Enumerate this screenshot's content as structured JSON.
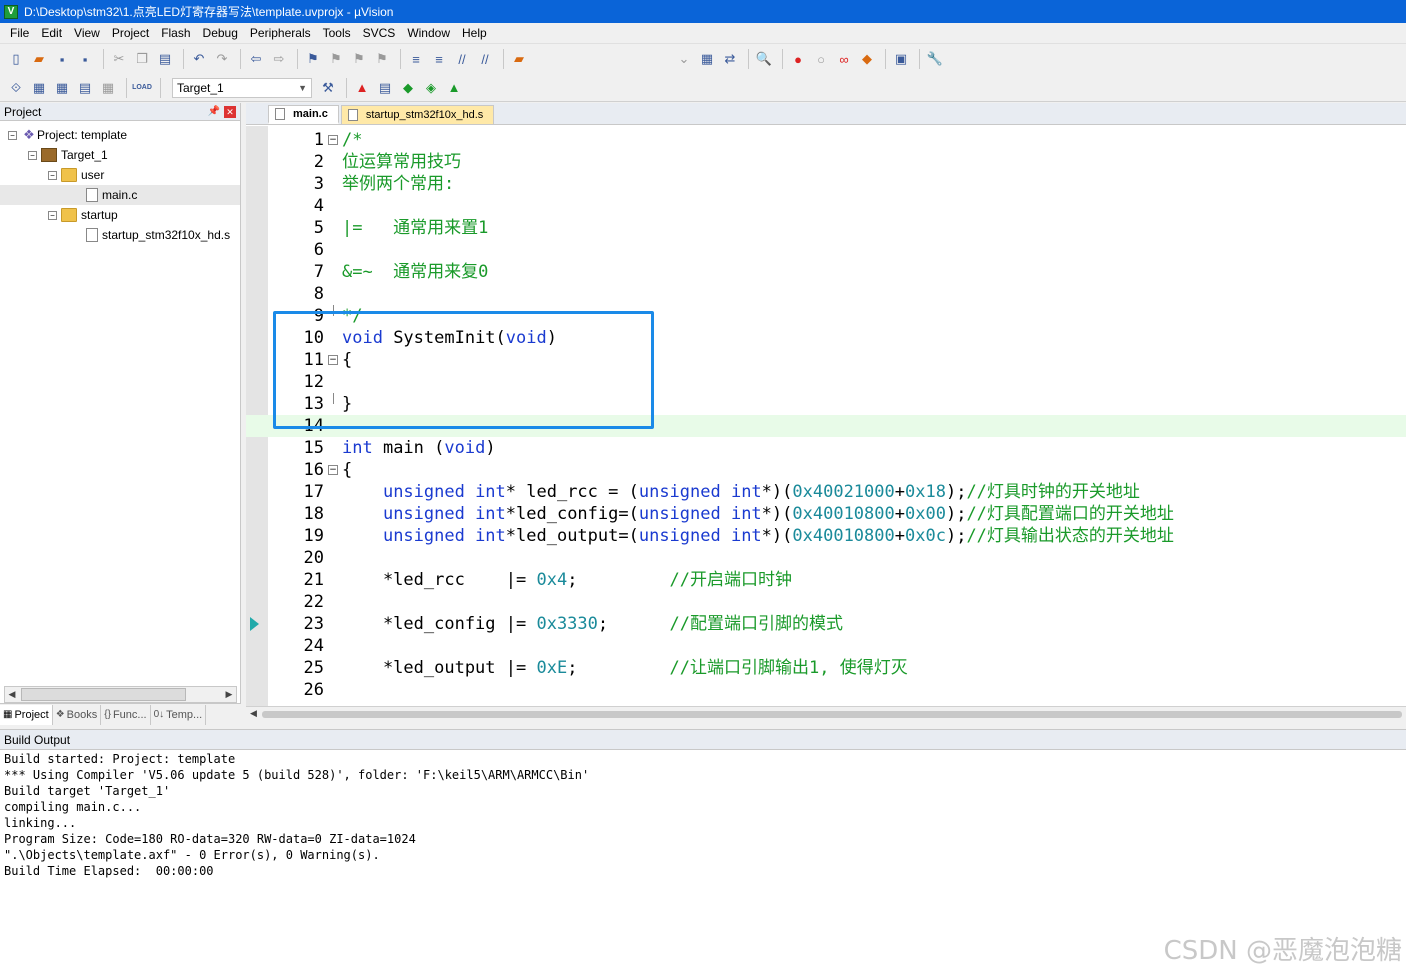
{
  "window": {
    "title": "D:\\Desktop\\stm32\\1.点亮LED灯寄存器写法\\template.uvprojx - µVision"
  },
  "menu": [
    "File",
    "Edit",
    "View",
    "Project",
    "Flash",
    "Debug",
    "Peripherals",
    "Tools",
    "SVCS",
    "Window",
    "Help"
  ],
  "toolbar2": {
    "target": "Target_1",
    "load_label": "LOAD"
  },
  "project_panel": {
    "title": "Project",
    "tree": [
      {
        "label": "Project: template",
        "level": 0
      },
      {
        "label": "Target_1",
        "level": 1
      },
      {
        "label": "user",
        "level": 2
      },
      {
        "label": "main.c",
        "level": 3
      },
      {
        "label": "startup",
        "level": 2
      },
      {
        "label": "startup_stm32f10x_hd.s",
        "level": 3
      }
    ],
    "tabs": [
      "Project",
      "Books",
      "Func...",
      "Temp..."
    ]
  },
  "editor": {
    "tabs": [
      "main.c",
      "startup_stm32f10x_hd.s"
    ],
    "lines": [
      {
        "n": "1",
        "fold": "minus",
        "parts": [
          {
            "c": "comment",
            "t": "/*"
          }
        ]
      },
      {
        "n": "2",
        "parts": [
          {
            "c": "comment",
            "t": "位运算常用技巧"
          }
        ]
      },
      {
        "n": "3",
        "parts": [
          {
            "c": "comment",
            "t": "举例两个常用:"
          }
        ]
      },
      {
        "n": "4",
        "parts": []
      },
      {
        "n": "5",
        "parts": [
          {
            "c": "comment",
            "t": "|=   通常用来置1"
          }
        ]
      },
      {
        "n": "6",
        "parts": []
      },
      {
        "n": "7",
        "parts": [
          {
            "c": "comment",
            "t": "&=~  通常用来复0"
          }
        ]
      },
      {
        "n": "8",
        "parts": []
      },
      {
        "n": "9",
        "fold": "end",
        "parts": [
          {
            "c": "comment",
            "t": "*/"
          }
        ]
      },
      {
        "n": "10",
        "parts": [
          {
            "c": "kw",
            "t": "void"
          },
          {
            "c": "plain",
            "t": " SystemInit("
          },
          {
            "c": "kw",
            "t": "void"
          },
          {
            "c": "plain",
            "t": ")"
          }
        ]
      },
      {
        "n": "11",
        "fold": "minus",
        "parts": [
          {
            "c": "plain",
            "t": "{"
          }
        ]
      },
      {
        "n": "12",
        "parts": []
      },
      {
        "n": "13",
        "fold": "end",
        "parts": [
          {
            "c": "plain",
            "t": "}"
          }
        ]
      },
      {
        "n": "14",
        "current": true,
        "parts": []
      },
      {
        "n": "15",
        "parts": [
          {
            "c": "kw",
            "t": "int"
          },
          {
            "c": "plain",
            "t": " main ("
          },
          {
            "c": "kw",
            "t": "void"
          },
          {
            "c": "plain",
            "t": ")"
          }
        ]
      },
      {
        "n": "16",
        "fold": "minus",
        "parts": [
          {
            "c": "plain",
            "t": "{"
          }
        ]
      },
      {
        "n": "17",
        "parts": [
          {
            "c": "plain",
            "t": "    "
          },
          {
            "c": "kw",
            "t": "unsigned int"
          },
          {
            "c": "plain",
            "t": "* led_rcc = ("
          },
          {
            "c": "kw",
            "t": "unsigned int"
          },
          {
            "c": "plain",
            "t": "*)("
          },
          {
            "c": "num",
            "t": "0x40021000"
          },
          {
            "c": "plain",
            "t": "+"
          },
          {
            "c": "num",
            "t": "0x18"
          },
          {
            "c": "plain",
            "t": ");"
          },
          {
            "c": "comment",
            "t": "//灯具时钟的开关地址"
          }
        ]
      },
      {
        "n": "18",
        "parts": [
          {
            "c": "plain",
            "t": "    "
          },
          {
            "c": "kw",
            "t": "unsigned int"
          },
          {
            "c": "plain",
            "t": "*led_config=("
          },
          {
            "c": "kw",
            "t": "unsigned int"
          },
          {
            "c": "plain",
            "t": "*)("
          },
          {
            "c": "num",
            "t": "0x40010800"
          },
          {
            "c": "plain",
            "t": "+"
          },
          {
            "c": "num",
            "t": "0x00"
          },
          {
            "c": "plain",
            "t": ");"
          },
          {
            "c": "comment",
            "t": "//灯具配置端口的开关地址"
          }
        ]
      },
      {
        "n": "19",
        "parts": [
          {
            "c": "plain",
            "t": "    "
          },
          {
            "c": "kw",
            "t": "unsigned int"
          },
          {
            "c": "plain",
            "t": "*led_output=("
          },
          {
            "c": "kw",
            "t": "unsigned int"
          },
          {
            "c": "plain",
            "t": "*)("
          },
          {
            "c": "num",
            "t": "0x40010800"
          },
          {
            "c": "plain",
            "t": "+"
          },
          {
            "c": "num",
            "t": "0x0c"
          },
          {
            "c": "plain",
            "t": ");"
          },
          {
            "c": "comment",
            "t": "//灯具输出状态的开关地址"
          }
        ]
      },
      {
        "n": "20",
        "parts": []
      },
      {
        "n": "21",
        "parts": [
          {
            "c": "plain",
            "t": "    *led_rcc    |= "
          },
          {
            "c": "num",
            "t": "0x4"
          },
          {
            "c": "plain",
            "t": ";         "
          },
          {
            "c": "comment",
            "t": "//开启端口时钟"
          }
        ]
      },
      {
        "n": "22",
        "parts": []
      },
      {
        "n": "23",
        "arrow": true,
        "parts": [
          {
            "c": "plain",
            "t": "    *led_config |= "
          },
          {
            "c": "num",
            "t": "0x3330"
          },
          {
            "c": "plain",
            "t": ";      "
          },
          {
            "c": "comment",
            "t": "//配置端口引脚的模式"
          }
        ]
      },
      {
        "n": "24",
        "parts": []
      },
      {
        "n": "25",
        "parts": [
          {
            "c": "plain",
            "t": "    *led_output |= "
          },
          {
            "c": "num",
            "t": "0xE"
          },
          {
            "c": "plain",
            "t": ";         "
          },
          {
            "c": "comment",
            "t": "//让端口引脚输出1, 使得灯灭"
          }
        ]
      },
      {
        "n": "26",
        "parts": []
      }
    ]
  },
  "build_output": {
    "title": "Build Output",
    "lines": [
      "Build started: Project: template",
      "*** Using Compiler 'V5.06 update 5 (build 528)', folder: 'F:\\keil5\\ARM\\ARMCC\\Bin'",
      "Build target 'Target_1'",
      "compiling main.c...",
      "linking...",
      "Program Size: Code=180 RO-data=320 RW-data=0 ZI-data=1024",
      "\".\\Objects\\template.axf\" - 0 Error(s), 0 Warning(s).",
      "Build Time Elapsed:  00:00:00"
    ]
  },
  "watermark": "CSDN @恶魔泡泡糖",
  "colors": {
    "title_bar": "#0a64d8",
    "highlight_box": "#1a8ae8",
    "comment": "#1a9a2a",
    "keyword": "#1a3ad0",
    "number": "#1a8a9a"
  }
}
